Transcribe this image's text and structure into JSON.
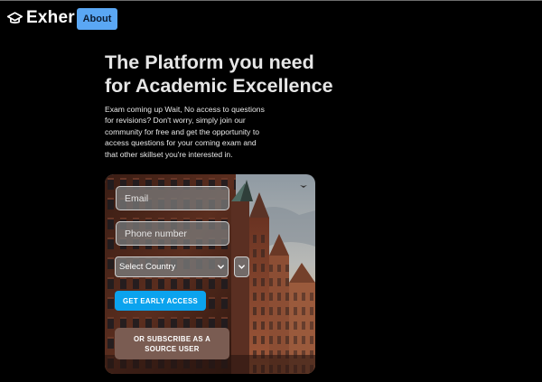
{
  "brand": {
    "name": "Exher",
    "logo_icon": "graduation-cap-icon"
  },
  "nav": {
    "about_label": "About"
  },
  "hero": {
    "title_line1": "The Platform you need",
    "title_line2": "for Academic Excellence",
    "description": "Exam coming up Wait, No access to questions for revisions? Don't worry, simply join our community for free and get the opportunity to access questions for your coming exam and that other skillset you're interested in."
  },
  "form": {
    "email_placeholder": "Email",
    "phone_placeholder": "Phone number",
    "country_select_value": "Select Country",
    "secondary_select_value": "",
    "early_access_label": "GET EARLY ACCESS",
    "subscribe_label": "OR SUBSCRIBE AS A SOURCE USER"
  },
  "colors": {
    "background": "#000000",
    "about_button": "#5aa7f4",
    "early_access_button": "#0ba3ee",
    "subscribe_button": "#7a5c52"
  }
}
